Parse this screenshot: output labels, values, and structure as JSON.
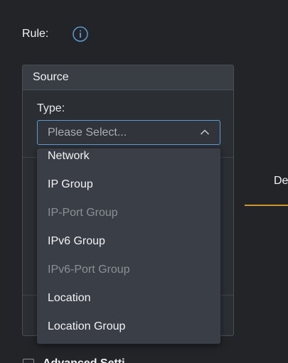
{
  "rule": {
    "label": "Rule:",
    "info_icon": "info-icon"
  },
  "source": {
    "title": "Source",
    "type_label": "Type:",
    "select": {
      "placeholder": "Please Select...",
      "icon": "chevron-up-icon"
    },
    "options": [
      {
        "label": "Network",
        "disabled": false
      },
      {
        "label": "IP Group",
        "disabled": false
      },
      {
        "label": "IP-Port Group",
        "disabled": true
      },
      {
        "label": "IPv6 Group",
        "disabled": false
      },
      {
        "label": "IPv6-Port Group",
        "disabled": true
      },
      {
        "label": "Location",
        "disabled": false
      },
      {
        "label": "Location Group",
        "disabled": false
      }
    ]
  },
  "destination": {
    "label": "De",
    "underline_color": "#c9952c"
  },
  "advanced": {
    "label": "Advanced Setti"
  },
  "colors": {
    "accent_blue": "#5b9bd5",
    "background": "#222428",
    "dropdown_bg": "#3a3e46"
  }
}
